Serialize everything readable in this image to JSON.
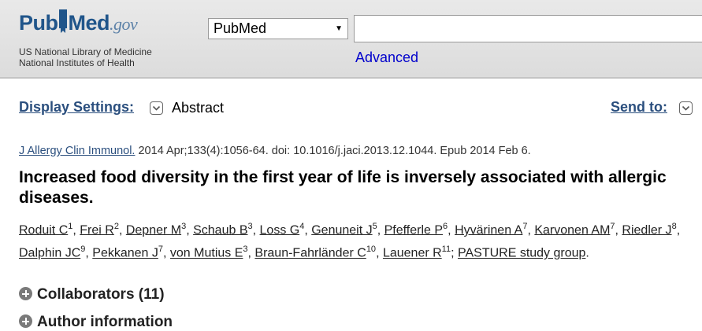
{
  "header": {
    "logo": {
      "pub": "Pub",
      "med": "Med",
      "gov": ".gov"
    },
    "org_line1": "US National Library of Medicine",
    "org_line2": "National Institutes of Health",
    "database_select": "PubMed",
    "search_value": "",
    "advanced_label": "Advanced"
  },
  "display_bar": {
    "display_settings_label": "Display Settings:",
    "format": "Abstract",
    "send_to_label": "Send to:"
  },
  "article": {
    "journal": "J Allergy Clin Immunol.",
    "citation_rest": " 2014 Apr;133(4):1056-64. doi: 10.1016/j.jaci.2013.12.1044. Epub 2014 Feb 6.",
    "title": "Increased food diversity in the first year of life is inversely associated with allergic diseases.",
    "authors": [
      {
        "name": "Roduit C",
        "aff": "1"
      },
      {
        "name": "Frei R",
        "aff": "2"
      },
      {
        "name": "Depner M",
        "aff": "3"
      },
      {
        "name": "Schaub B",
        "aff": "3"
      },
      {
        "name": "Loss G",
        "aff": "4"
      },
      {
        "name": "Genuneit J",
        "aff": "5"
      },
      {
        "name": "Pfefferle P",
        "aff": "6"
      },
      {
        "name": "Hyvärinen A",
        "aff": "7"
      },
      {
        "name": "Karvonen AM",
        "aff": "7"
      },
      {
        "name": "Riedler J",
        "aff": "8"
      },
      {
        "name": "Dalphin JC",
        "aff": "9"
      },
      {
        "name": "Pekkanen J",
        "aff": "7"
      },
      {
        "name": "von Mutius E",
        "aff": "3"
      },
      {
        "name": "Braun-Fahrländer C",
        "aff": "10"
      },
      {
        "name": "Lauener R",
        "aff": "11"
      }
    ],
    "group": "PASTURE study group"
  },
  "sections": {
    "collaborators": "Collaborators (11)",
    "author_info": "Author information"
  }
}
